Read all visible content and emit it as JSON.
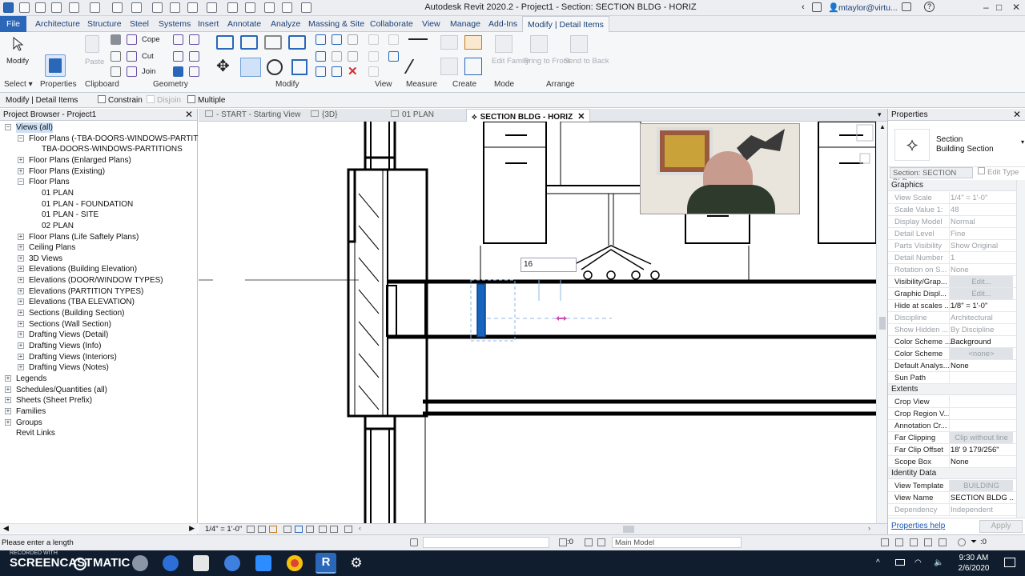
{
  "app": {
    "title": "Autodesk Revit 2020.2 - Project1 - Section: SECTION BLDG - HORIZ",
    "user": "mtaylor@virtu...",
    "window_controls": [
      "–",
      "□",
      "✕"
    ]
  },
  "ribbon_tabs": [
    "File",
    "Architecture",
    "Structure",
    "Steel",
    "Systems",
    "Insert",
    "Annotate",
    "Analyze",
    "Massing & Site",
    "Collaborate",
    "View",
    "Manage",
    "Add-Ins",
    "Modify | Detail Items"
  ],
  "ribbon": {
    "modify_label": "Modify",
    "paste_label": "Paste",
    "cope_label": "Cope",
    "cut_label": "Cut",
    "join_label": "Join",
    "edit_family_label": "Edit Family",
    "bring_to_front_label": "Bring to Front",
    "send_to_back_label": "Send to Back",
    "panels": [
      "Select",
      "Properties",
      "Clipboard",
      "Geometry",
      "Modify",
      "View",
      "Measure",
      "Create",
      "Mode",
      "Arrange"
    ]
  },
  "options_bar": {
    "context": "Modify | Detail Items",
    "constrain": "Constrain",
    "disjoin": "Disjoin",
    "multiple": "Multiple"
  },
  "project_browser": {
    "title": "Project Browser - Project1",
    "items": [
      {
        "label": "Views (all)",
        "toggle": "−",
        "selected": true
      },
      {
        "label": "Floor Plans (-TBA-DOORS-WINDOWS-PARTITIONS",
        "toggle": "−"
      },
      {
        "label": "TBA-DOORS-WINDOWS-PARTITIONS",
        "toggle": ""
      },
      {
        "label": "Floor Plans (Enlarged Plans)",
        "toggle": "+"
      },
      {
        "label": "Floor Plans (Existing)",
        "toggle": "+"
      },
      {
        "label": "Floor Plans",
        "toggle": "−"
      },
      {
        "label": "01 PLAN",
        "toggle": ""
      },
      {
        "label": "01 PLAN - FOUNDATION",
        "toggle": ""
      },
      {
        "label": "01 PLAN - SITE",
        "toggle": ""
      },
      {
        "label": "02 PLAN",
        "toggle": ""
      },
      {
        "label": "Floor Plans (Life Saftely Plans)",
        "toggle": "+"
      },
      {
        "label": "Ceiling Plans",
        "toggle": "+"
      },
      {
        "label": "3D Views",
        "toggle": "+"
      },
      {
        "label": "Elevations (Building Elevation)",
        "toggle": "+"
      },
      {
        "label": "Elevations (DOOR/WINDOW TYPES)",
        "toggle": "+"
      },
      {
        "label": "Elevations (PARTITION TYPES)",
        "toggle": "+"
      },
      {
        "label": "Elevations (TBA ELEVATION)",
        "toggle": "+"
      },
      {
        "label": "Sections (Building Section)",
        "toggle": "+"
      },
      {
        "label": "Sections (Wall Section)",
        "toggle": "+"
      },
      {
        "label": "Drafting Views (Detail)",
        "toggle": "+"
      },
      {
        "label": "Drafting Views (Info)",
        "toggle": "+"
      },
      {
        "label": "Drafting Views (Interiors)",
        "toggle": "+"
      },
      {
        "label": "Drafting Views (Notes)",
        "toggle": "+"
      },
      {
        "label": "Legends",
        "toggle": "+"
      },
      {
        "label": "Schedules/Quantities (all)",
        "toggle": "+"
      },
      {
        "label": "Sheets (Sheet Prefix)",
        "toggle": "+"
      },
      {
        "label": "Families",
        "toggle": "+"
      },
      {
        "label": "Groups",
        "toggle": "+"
      },
      {
        "label": "Revit Links",
        "toggle": ""
      }
    ]
  },
  "view_tabs": [
    {
      "label": "- START - Starting View",
      "active": false
    },
    {
      "label": "{3D}",
      "active": false
    },
    {
      "label": "01 PLAN",
      "active": false
    },
    {
      "label": "SECTION BLDG - HORIZ",
      "active": true
    }
  ],
  "canvas": {
    "length_input": "16"
  },
  "view_control": {
    "scale": "1/4\" = 1'-0\""
  },
  "properties": {
    "title": "Properties",
    "type_name": "Section",
    "type_sub": "Building Section",
    "instance_selector": "Section: SECTION BLD",
    "edit_type": "Edit Type",
    "sections": [
      {
        "name": "Graphics",
        "rows": [
          {
            "key": "View Scale",
            "value": "1/4\" = 1'-0\"",
            "dim": true
          },
          {
            "key": "Scale Value 1:",
            "value": "48",
            "dim": true
          },
          {
            "key": "Display Model",
            "value": "Normal",
            "dim": true
          },
          {
            "key": "Detail Level",
            "value": "Fine",
            "dim": true
          },
          {
            "key": "Parts Visibility",
            "value": "Show Original",
            "dim": true
          },
          {
            "key": "Detail Number",
            "value": "1",
            "dim": true
          },
          {
            "key": "Rotation on S...",
            "value": "None",
            "dim": true
          },
          {
            "key": "Visibility/Grap...",
            "value": "Edit...",
            "grey": true
          },
          {
            "key": "Graphic Displ...",
            "value": "Edit...",
            "grey": true
          },
          {
            "key": "Hide at scales ...",
            "value": "1/8\" = 1'-0\""
          },
          {
            "key": "Discipline",
            "value": "Architectural",
            "dim": true
          },
          {
            "key": "Show Hidden ...",
            "value": "By Discipline",
            "dim": true
          },
          {
            "key": "Color Scheme ...",
            "value": "Background"
          },
          {
            "key": "Color Scheme",
            "value": "<none>",
            "grey": true
          },
          {
            "key": "Default Analys...",
            "value": "None"
          },
          {
            "key": "Sun Path",
            "value": ""
          }
        ]
      },
      {
        "name": "Extents",
        "rows": [
          {
            "key": "Crop View",
            "value": ""
          },
          {
            "key": "Crop Region V...",
            "value": ""
          },
          {
            "key": "Annotation Cr...",
            "value": ""
          },
          {
            "key": "Far Clipping",
            "value": "Clip without line",
            "grey": true
          },
          {
            "key": "Far Clip Offset",
            "value": "18' 9 179/256\""
          },
          {
            "key": "Scope Box",
            "value": "None"
          }
        ]
      },
      {
        "name": "Identity Data",
        "rows": [
          {
            "key": "View Template",
            "value": "BUILDING",
            "grey": true
          },
          {
            "key": "View Name",
            "value": "SECTION BLDG ..."
          },
          {
            "key": "Dependency",
            "value": "Independent",
            "dim": true
          }
        ]
      }
    ],
    "help": "Properties help",
    "apply": "Apply"
  },
  "status": {
    "message": "Please enter a length",
    "zero": ":0",
    "model": "Main Model",
    "filter": ":0"
  },
  "taskbar": {
    "watermark": "SCREENCAST",
    "watermark2": "MATIC",
    "recorded": "RECORDED WITH",
    "time": "9:30 AM",
    "date": "2/6/2020"
  },
  "colors": {
    "accent": "#2a67b8",
    "highlight": "#1565c0",
    "taskbar": "#0f1d2e"
  }
}
